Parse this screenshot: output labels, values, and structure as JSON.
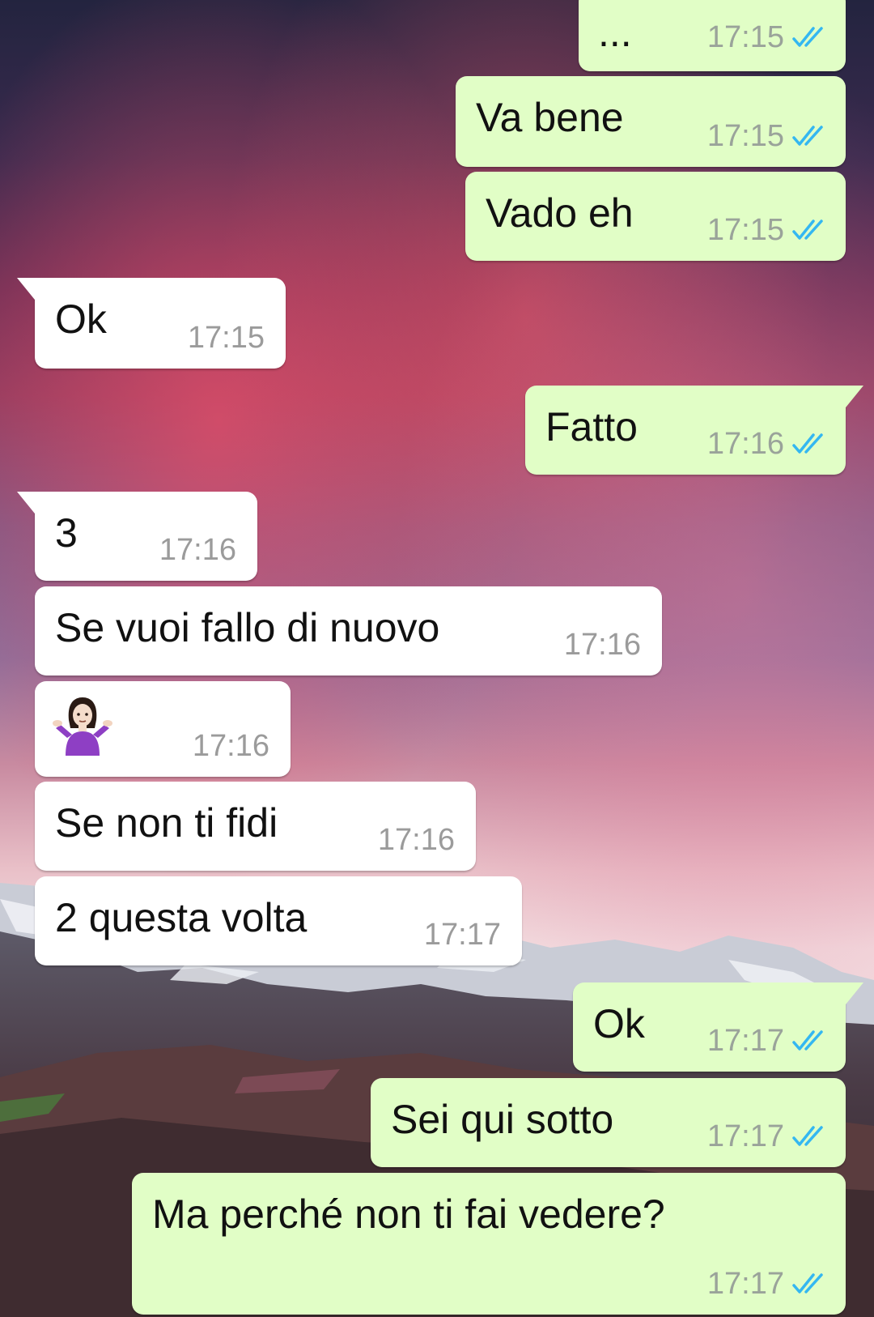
{
  "colors": {
    "outgoing_bubble": "#e1fec6",
    "incoming_bubble": "#ffffff",
    "read_ticks": "#34b7f1",
    "timestamp": "#9aa39a"
  },
  "icons": {
    "read_status": "double-check-icon",
    "emoji": "person-shrugging-emoji"
  },
  "messages": [
    {
      "direction": "outgoing",
      "text": "...",
      "time": "17:15",
      "status": "read"
    },
    {
      "direction": "outgoing",
      "text": "Va bene",
      "time": "17:15",
      "status": "read"
    },
    {
      "direction": "outgoing",
      "text": "Vado eh",
      "time": "17:15",
      "status": "read"
    },
    {
      "direction": "incoming",
      "text": "Ok",
      "time": "17:15"
    },
    {
      "direction": "outgoing",
      "text": "Fatto",
      "time": "17:16",
      "status": "read"
    },
    {
      "direction": "incoming",
      "text": "3",
      "time": "17:16"
    },
    {
      "direction": "incoming",
      "text": "Se vuoi fallo di nuovo",
      "time": "17:16"
    },
    {
      "direction": "incoming",
      "text": "🤷🏻‍♀️",
      "time": "17:16",
      "emoji": true
    },
    {
      "direction": "incoming",
      "text": "Se non ti fidi",
      "time": "17:16"
    },
    {
      "direction": "incoming",
      "text": "2 questa volta",
      "time": "17:17"
    },
    {
      "direction": "outgoing",
      "text": "Ok",
      "time": "17:17",
      "status": "read"
    },
    {
      "direction": "outgoing",
      "text": "Sei qui sotto",
      "time": "17:17",
      "status": "read"
    },
    {
      "direction": "outgoing",
      "text": "Ma perché non ti fai vedere?",
      "time": "17:17",
      "status": "read"
    }
  ]
}
